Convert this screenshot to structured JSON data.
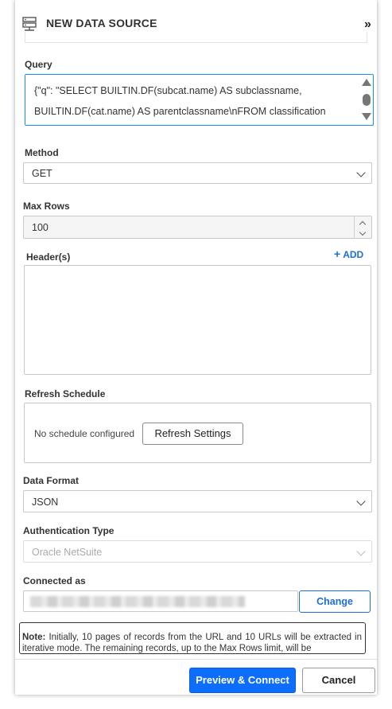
{
  "header": {
    "title": "NEW DATA SOURCE",
    "icon": "database-server-icon",
    "collapse_glyph": "»"
  },
  "query": {
    "label": "Query",
    "value": "{\"q\": \"SELECT BUILTIN.DF(subcat.name) AS subclassname, BUILTIN.DF(cat.name) AS parentclassname\\nFROM classification subcat\\nLEFT JOIN classification cat ON subcat.parent = cat.id\"}"
  },
  "method": {
    "label": "Method",
    "value": "GET"
  },
  "max_rows": {
    "label": "Max Rows",
    "value": "100"
  },
  "headers": {
    "label": "Header(s)",
    "add_label": "ADD"
  },
  "refresh": {
    "label": "Refresh Schedule",
    "status_text": "No schedule configured",
    "settings_button": "Refresh Settings"
  },
  "data_format": {
    "label": "Data Format",
    "value": "JSON"
  },
  "auth": {
    "label": "Authentication Type",
    "value": "Oracle NetSuite"
  },
  "connected": {
    "label": "Connected as",
    "change_button": "Change"
  },
  "note": {
    "prefix": "Note:",
    "text": " Initially, 10 pages of records from the URL and 10 URLs will be extracted in iterative mode. The remaining records, up to the Max Rows limit, will be"
  },
  "footer": {
    "primary_button": "Preview & Connect",
    "cancel_button": "Cancel"
  },
  "colors": {
    "accent": "#1d6fd6",
    "primary": "#0d6efd",
    "focus_border": "#1d8fe0"
  }
}
